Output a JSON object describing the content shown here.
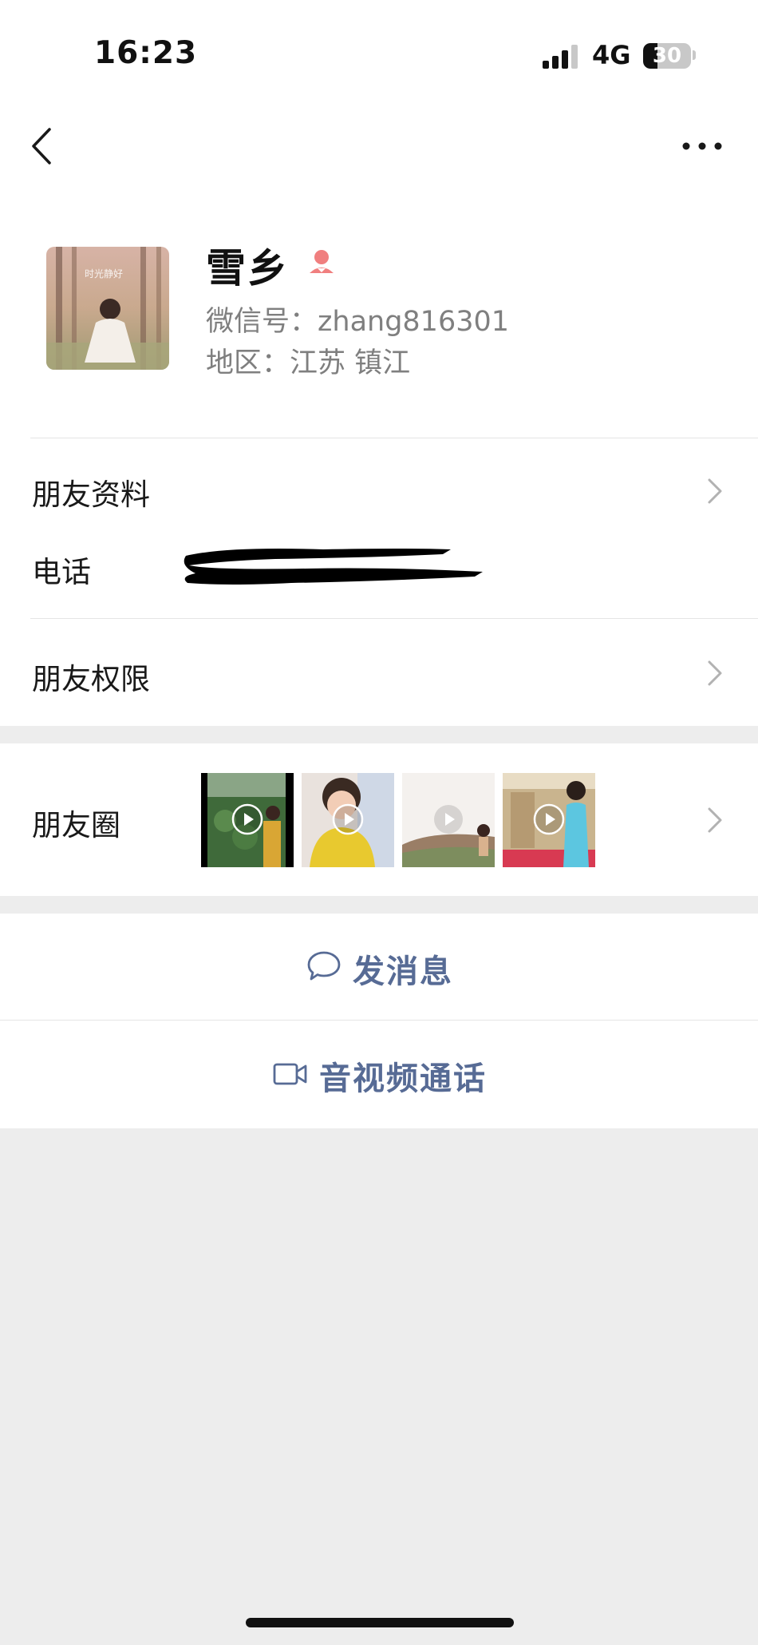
{
  "status_bar": {
    "time": "16:23",
    "network": "4G",
    "battery": "30"
  },
  "profile": {
    "name": "雪乡",
    "wechat_id_label": "微信号：",
    "wechat_id": "zhang816301",
    "region_label": "地区：",
    "region": "江苏 镇江",
    "avatar_text": "时光静好"
  },
  "rows": {
    "friend_info": "朋友资料",
    "phone": "电话",
    "permissions": "朋友权限",
    "moments": "朋友圈"
  },
  "actions": {
    "message": "发消息",
    "call": "音视频通话"
  },
  "colors": {
    "link": "#576b95",
    "gender_female": "#f07f7f",
    "background": "#ededed"
  }
}
